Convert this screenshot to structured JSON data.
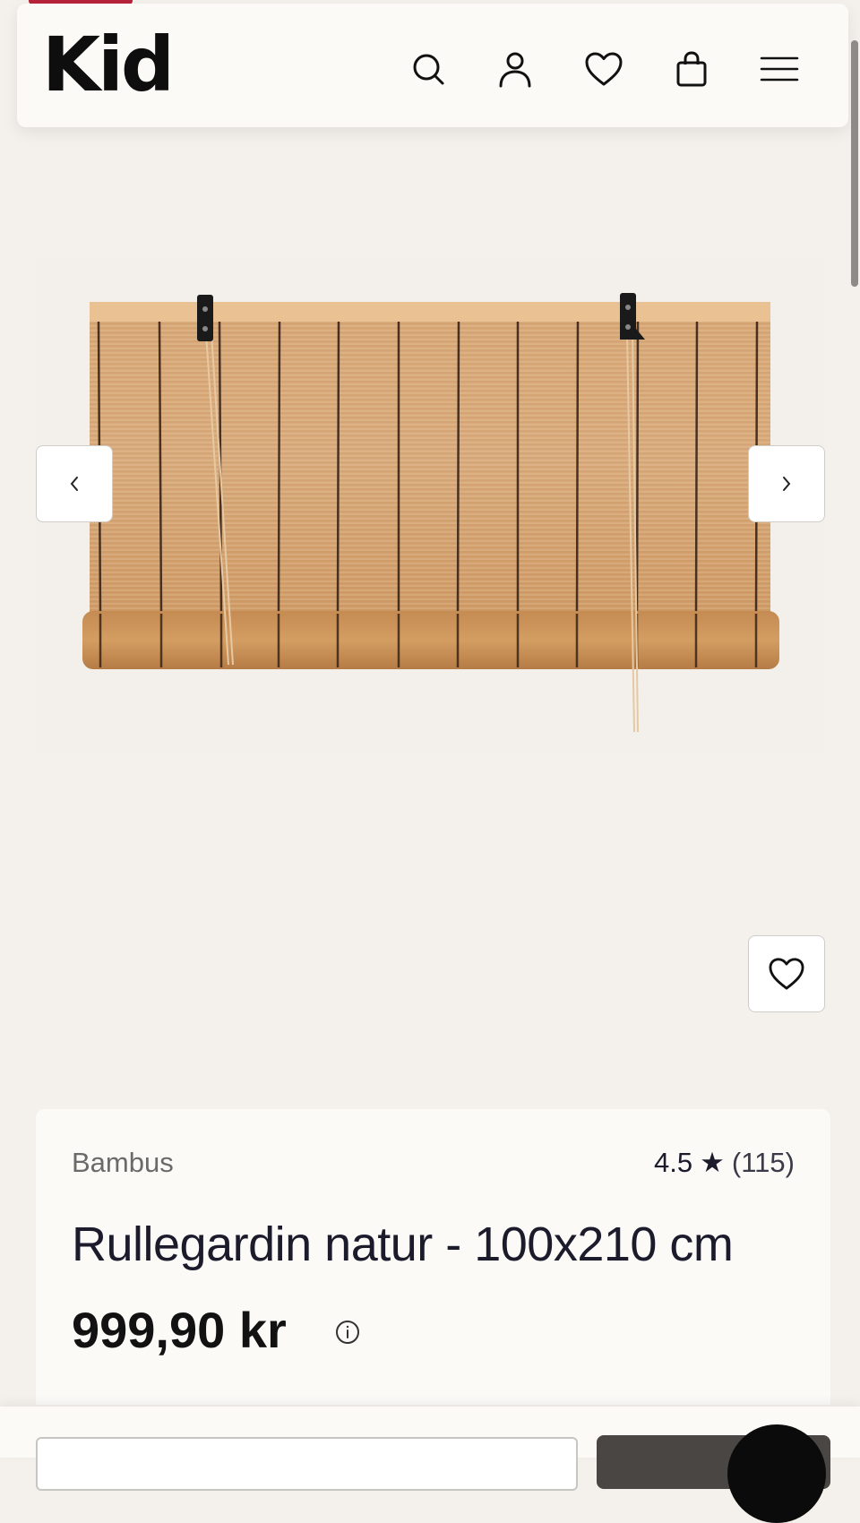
{
  "header": {
    "logo": "Kid",
    "icons": [
      "search-icon",
      "user-icon",
      "heart-icon",
      "shopping-bag-icon",
      "menu-icon"
    ]
  },
  "gallery": {
    "prev_icon": "chevron-left-icon",
    "next_icon": "chevron-right-icon",
    "wishlist_icon": "heart-icon"
  },
  "product": {
    "brand": "Bambus",
    "rating": "4.5",
    "rating_star": "★",
    "review_count": "(115)",
    "title": "Rullegardin natur - 100x210 cm",
    "price": "999,90 kr",
    "price_info_icon": "info-icon"
  },
  "colors": {
    "background": "#f4f1ec",
    "card": "#fbfaf7",
    "accent": "#b8243c",
    "text": "#1c1b2b",
    "bamboo_light": "#d9a877",
    "bamboo_dark": "#c18a52",
    "stripe": "#3a2417"
  }
}
